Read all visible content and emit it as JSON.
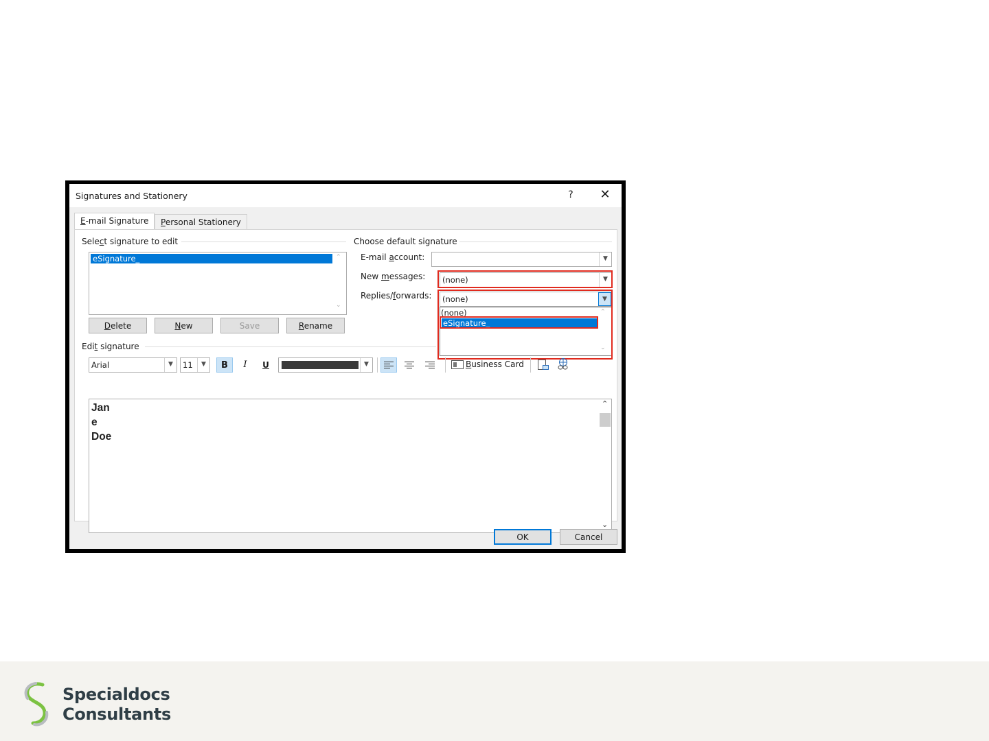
{
  "window": {
    "title": "Signatures and Stationery",
    "help_label": "?",
    "close_label": "✕"
  },
  "tabs": [
    {
      "pre": "",
      "key": "E",
      "post": "-mail Signature"
    },
    {
      "pre": "",
      "key": "P",
      "post": "ersonal Stationery"
    }
  ],
  "select_group": {
    "pre": "Sele",
    "key": "c",
    "post": "t signature to edit"
  },
  "signatures": [
    "eSignature_"
  ],
  "sig_buttons": {
    "delete": {
      "pre": "",
      "key": "D",
      "post": "elete"
    },
    "new": {
      "pre": "",
      "key": "N",
      "post": "ew"
    },
    "save": "Save",
    "rename": {
      "pre": "",
      "key": "R",
      "post": "ename"
    }
  },
  "default_group": {
    "label": "Choose default signature",
    "email_account": {
      "pre": "E-mail ",
      "key": "a",
      "post": "ccount:",
      "value": ""
    },
    "new_messages": {
      "pre": "New ",
      "key": "m",
      "post": "essages:",
      "value": "(none)"
    },
    "replies": {
      "pre": "Replies/",
      "key": "f",
      "post": "orwards:",
      "value": "(none)"
    },
    "dropdown_options": [
      "(none)",
      "eSignature_"
    ],
    "selected_option": "eSignature_"
  },
  "edit_group": {
    "pre": "Edi",
    "key": "t",
    "post": " signature"
  },
  "toolbar": {
    "font": "Arial",
    "size": "11",
    "bold": "B",
    "italic": "I",
    "underline": "U",
    "color": "#3a3a3a",
    "business_card": {
      "pre": "",
      "key": "B",
      "post": "usiness Card"
    }
  },
  "editor_lines": [
    "Jan",
    "e",
    "Doe"
  ],
  "dialog_buttons": {
    "ok": "OK",
    "cancel": "Cancel"
  },
  "brand": {
    "line1": "Specialdocs",
    "line2": "Consultants",
    "colors": {
      "green": "#7cc242",
      "gray": "#b8bcc0",
      "text": "#2f3e46"
    }
  },
  "colors": {
    "highlight": "#0078d7",
    "callout": "#e02a1e",
    "footer_bg": "#f4f3ef"
  }
}
